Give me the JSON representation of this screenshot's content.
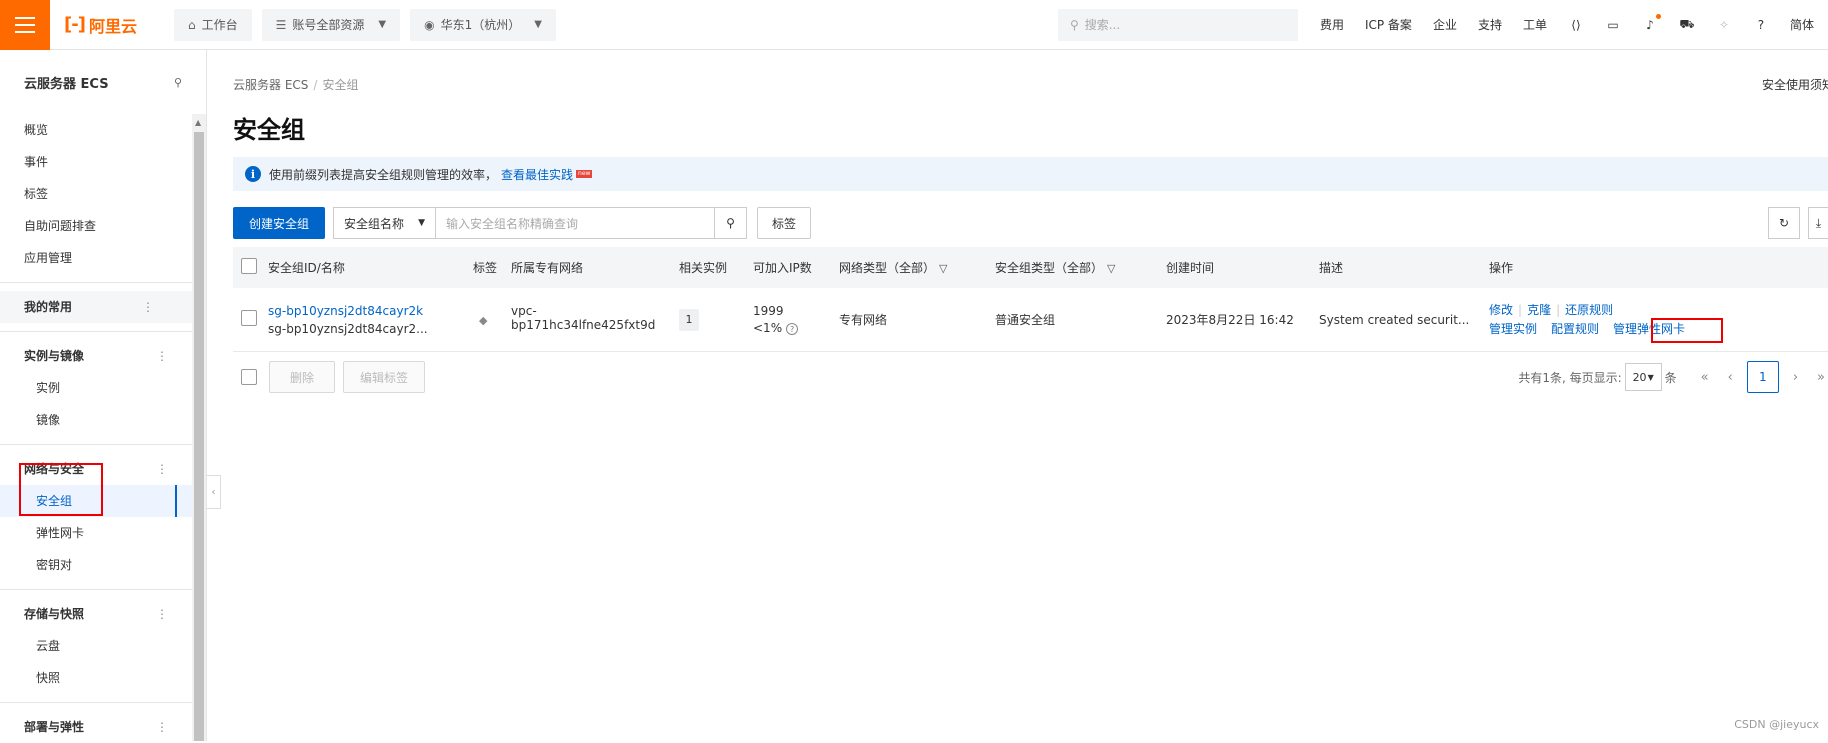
{
  "topbar": {
    "logo_text": "阿里云",
    "workbench": "工作台",
    "resources": "账号全部资源",
    "region": "华东1（杭州）",
    "search_placeholder": "搜索...",
    "links": [
      "费用",
      "ICP 备案",
      "企业",
      "支持",
      "工单"
    ],
    "lang": "简体"
  },
  "sidebar": {
    "title": "云服务器 ECS",
    "top_items": [
      "概览",
      "事件",
      "标签",
      "自助问题排查",
      "应用管理"
    ],
    "my_common": "我的常用",
    "groups": [
      {
        "label": "实例与镜像",
        "items": [
          "实例",
          "镜像"
        ]
      },
      {
        "label": "网络与安全",
        "items": [
          "安全组",
          "弹性网卡",
          "密钥对"
        ]
      },
      {
        "label": "存储与快照",
        "items": [
          "云盘",
          "快照"
        ]
      },
      {
        "label": "部署与弹性",
        "items": []
      }
    ],
    "more_glyph": "⋮"
  },
  "main": {
    "breadcrumb": [
      "云服务器 ECS",
      "安全组"
    ],
    "right_note": "安全使用须知",
    "title": "安全组",
    "notice_text": "使用前缀列表提高安全组规则管理的效率，",
    "notice_link": "查看最佳实践",
    "notice_badge": "new",
    "create_button": "创建安全组",
    "search_field": "安全组名称",
    "search_placeholder": "输入安全组名称精确查询",
    "tag_button": "标签",
    "columns": [
      "安全组ID/名称",
      "标签",
      "所属专有网络",
      "相关实例",
      "可加入IP数",
      "网络类型（全部）",
      "安全组类型（全部）",
      "创建时间",
      "描述",
      "操作"
    ],
    "rows": [
      {
        "id": "sg-bp10yznsj2dt84cayr2k",
        "name": "sg-bp10yznsj2dt84cayr2...",
        "vpc": "vpc-bp171hc34lfne425fxt9d",
        "instances": "1",
        "ip_count": "1999",
        "ip_pct": "<1%",
        "net_type": "专有网络",
        "sg_type": "普通安全组",
        "created": "2023年8月22日 16:42",
        "desc": "System created securit...",
        "ops_line1": [
          "修改",
          "克隆",
          "还原规则"
        ],
        "ops_line2": [
          "管理实例",
          "配置规则",
          "管理弹性网卡"
        ]
      }
    ],
    "delete_button": "删除",
    "edit_tag_button": "编辑标签",
    "pager_total": "共有1条, 每页显示:",
    "pager_size": "20",
    "pager_unit": "条",
    "pager_current": "1"
  },
  "watermark": "CSDN @jieyucx",
  "colors": {
    "brand": "#ff6a00",
    "primary": "#0064c8",
    "highlight": "#e00000"
  }
}
